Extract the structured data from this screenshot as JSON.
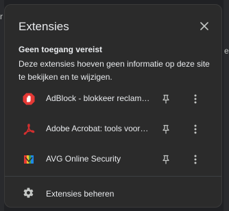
{
  "background_edges": {
    "left_glyph": "r",
    "right_glyph": "e"
  },
  "panel": {
    "title": "Extensies",
    "close_icon": "close-icon",
    "section": {
      "title": "Geen toegang vereist",
      "description": "Deze extensies hoeven geen informatie op deze site te bekijken en te wijzigen."
    },
    "extensions": [
      {
        "name": "AdBlock - blokkeer reclame en pop-ups",
        "icon": "adblock-icon",
        "color": "#e53935"
      },
      {
        "name": "Adobe Acrobat: tools voor PDF bewerken",
        "icon": "acrobat-icon",
        "color": "#d32f2f"
      },
      {
        "name": "AVG Online Security",
        "icon": "avg-icon",
        "color": "#4a7a2a"
      }
    ],
    "manage_label": "Extensies beheren"
  },
  "colors": {
    "panel_bg": "#2b2b2b",
    "text": "#e8eaed",
    "icon": "#c4c7c5",
    "divider": "#3c4043"
  }
}
